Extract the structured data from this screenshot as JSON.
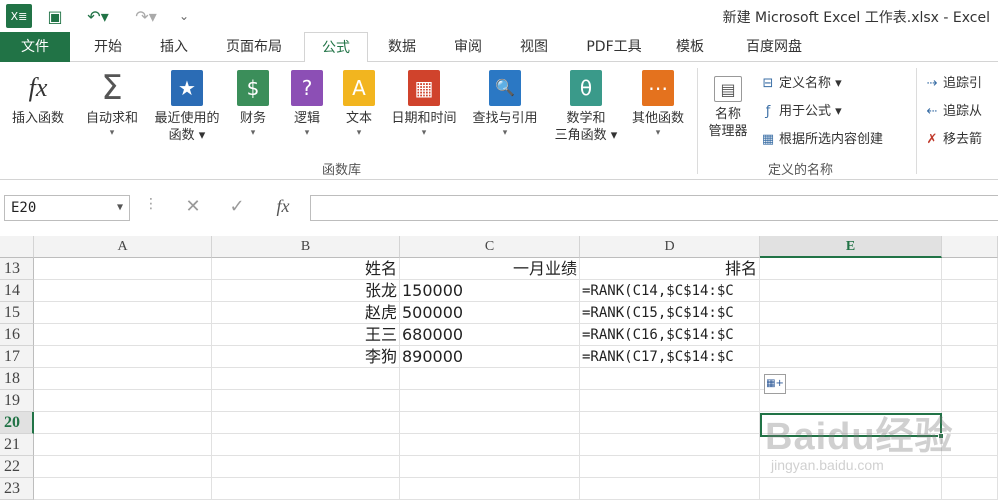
{
  "titlebar": {
    "title": "新建 Microsoft Excel 工作表.xlsx - Excel",
    "excel_icon": "X≣",
    "save_icon": "▣",
    "undo_icon": "↶▾",
    "redo_icon": "↷▾",
    "customize_icon": "⌄"
  },
  "tabs": [
    "文件",
    "开始",
    "插入",
    "页面布局",
    "公式",
    "数据",
    "审阅",
    "视图",
    "PDF工具",
    "模板",
    "百度网盘"
  ],
  "ribbon": {
    "buttons": [
      {
        "label": "插入函数",
        "label2": "",
        "icon": "fx",
        "color": "#ffffff"
      },
      {
        "label": "自动求和",
        "label2": "",
        "icon": "Σ",
        "color": "#ffffff"
      },
      {
        "label": "最近使用的",
        "label2": "函数 ▾",
        "icon": "★",
        "color": "#2b6cb5"
      },
      {
        "label": "财务",
        "label2": "",
        "icon": "$",
        "color": "#3b8e5a"
      },
      {
        "label": "逻辑",
        "label2": "",
        "icon": "?",
        "color": "#8c4fb5"
      },
      {
        "label": "文本",
        "label2": "",
        "icon": "A",
        "color": "#f2b51f"
      },
      {
        "label": "日期和时间",
        "label2": "",
        "icon": "▦",
        "color": "#d0432c"
      },
      {
        "label": "查找与引用",
        "label2": "",
        "icon": "🔍",
        "color": "#2b78c4"
      },
      {
        "label": "数学和",
        "label2": "三角函数 ▾",
        "icon": "θ",
        "color": "#3a9a8a"
      },
      {
        "label": "其他函数",
        "label2": "",
        "icon": "⋯",
        "color": "#e4721e"
      },
      {
        "label": "名称",
        "label2": "管理器",
        "icon": "▤",
        "color": "#ffffff"
      }
    ],
    "group_function_library": "函数库",
    "group_defined_names": "定义的名称",
    "names_small": [
      "定义名称 ▾",
      "用于公式 ▾",
      "根据所选内容创建"
    ],
    "audit_small": [
      "追踪引",
      "追踪从",
      "移去箭"
    ]
  },
  "formula_bar": {
    "name_box": "E20",
    "cancel_icon": "✕",
    "enter_icon": "✓",
    "fx_icon": "fx",
    "value": ""
  },
  "columns": [
    "A",
    "B",
    "C",
    "D",
    "E"
  ],
  "selected_column": "E",
  "rows": [
    {
      "num": "13",
      "b": "姓名",
      "c": "一月业绩",
      "d": "排名"
    },
    {
      "num": "14",
      "b": "张龙",
      "c": "150000",
      "d": "=RANK(C14,$C$14:$C"
    },
    {
      "num": "15",
      "b": "赵虎",
      "c": "500000",
      "d": "=RANK(C15,$C$14:$C"
    },
    {
      "num": "16",
      "b": "王三",
      "c": "680000",
      "d": "=RANK(C16,$C$14:$C"
    },
    {
      "num": "17",
      "b": "李狗",
      "c": "890000",
      "d": "=RANK(C17,$C$14:$C"
    },
    {
      "num": "18",
      "b": "",
      "c": "",
      "d": ""
    },
    {
      "num": "19",
      "b": "",
      "c": "",
      "d": ""
    },
    {
      "num": "20",
      "b": "",
      "c": "",
      "d": ""
    },
    {
      "num": "21",
      "b": "",
      "c": "",
      "d": ""
    },
    {
      "num": "22",
      "b": "",
      "c": "",
      "d": ""
    },
    {
      "num": "23",
      "b": "",
      "c": "",
      "d": ""
    }
  ],
  "selected_row": "20",
  "watermark": {
    "main": "Baidu经验",
    "sub": "jingyan.baidu.com"
  },
  "colors": {
    "excel_green": "#217346"
  }
}
